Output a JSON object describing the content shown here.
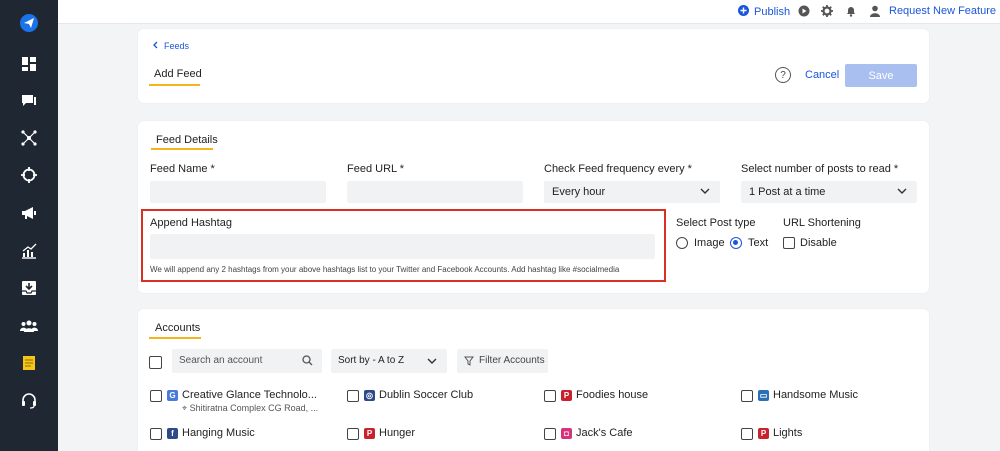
{
  "sidebar": {
    "items": [
      {
        "icon": "send-logo-icon"
      },
      {
        "icon": "dashboard-icon"
      },
      {
        "icon": "messages-icon"
      },
      {
        "icon": "network-icon"
      },
      {
        "icon": "target-icon"
      },
      {
        "icon": "megaphone-icon"
      },
      {
        "icon": "analytics-icon"
      },
      {
        "icon": "inbox-download-icon"
      },
      {
        "icon": "team-icon"
      },
      {
        "icon": "notes-icon"
      },
      {
        "icon": "support-headset-icon"
      }
    ]
  },
  "topbar": {
    "publish_label": "Publish",
    "request_feature_label": "Request New Feature"
  },
  "header": {
    "breadcrumb": "Feeds",
    "title": "Add Feed",
    "help_label": "?",
    "cancel_label": "Cancel",
    "save_label": "Save"
  },
  "feed_details": {
    "section_title": "Feed Details",
    "feed_name_label": "Feed Name *",
    "feed_url_label": "Feed URL *",
    "frequency_label": "Check Feed frequency every *",
    "frequency_value": "Every hour",
    "posts_label": "Select number of posts to read *",
    "posts_value": "1 Post at a time",
    "hashtag_label": "Append Hashtag",
    "hashtag_help": "We will append any 2 hashtags from your above hashtags list to your Twitter and Facebook Accounts. Add hashtag like #socialmedia",
    "post_type_label": "Select Post type",
    "post_type_options": [
      "Image",
      "Text"
    ],
    "post_type_selected": "Text",
    "url_shortening_label": "URL Shortening",
    "url_shortening_option": "Disable"
  },
  "accounts": {
    "section_title": "Accounts",
    "search_placeholder": "Search an account",
    "sort_label": "Sort by - A to Z",
    "filter_label": "Filter Accounts",
    "items": [
      {
        "name": "Creative Glance Technolo...",
        "location": "Shitiratna Complex CG Road, ...",
        "network": "google-business",
        "color": "#4a7bd8"
      },
      {
        "name": "Dublin Soccer Club",
        "network": "facebook-group",
        "color": "#2d4a8a"
      },
      {
        "name": "Foodies house",
        "network": "pinterest",
        "color": "#c8232c"
      },
      {
        "name": "Handsome Music",
        "network": "instagram-business",
        "color": "#2a6fb8"
      },
      {
        "name": "Hanging Music",
        "network": "facebook",
        "color": "#2d4a8a"
      },
      {
        "name": "Hunger",
        "network": "pinterest",
        "color": "#c8232c"
      },
      {
        "name": "Jack's Cafe",
        "network": "instagram",
        "color": "#d6337a"
      },
      {
        "name": "Lights",
        "network": "pinterest",
        "color": "#c8232c"
      }
    ]
  },
  "colors": {
    "accent_blue": "#1a56db",
    "tab_underline": "#f5b51e",
    "highlight_border": "#d93025",
    "save_disabled": "#a9bff0",
    "sidebar_bg": "#1f2733"
  }
}
